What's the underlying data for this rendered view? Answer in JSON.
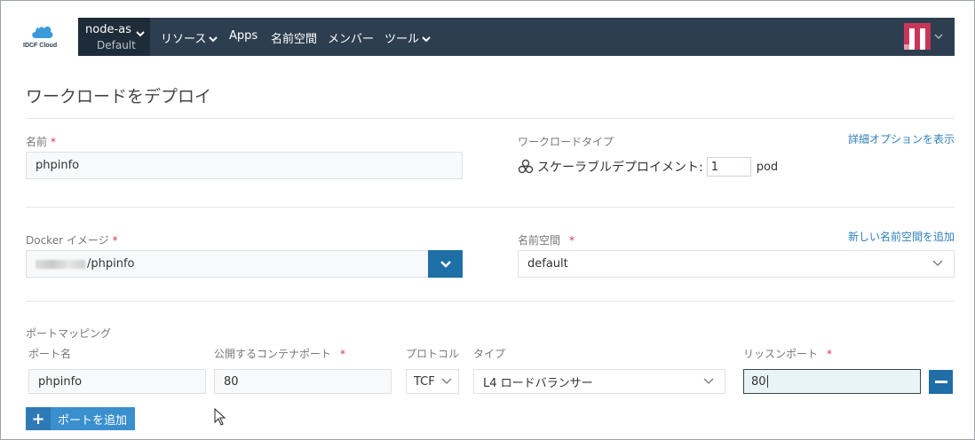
{
  "header": {
    "logo_text": "IDCF Cloud",
    "cluster": {
      "name": "node-as",
      "project": "Default"
    },
    "nav": [
      {
        "label": "リソース",
        "dropdown": true
      },
      {
        "label": "Apps",
        "dropdown": false
      },
      {
        "label": "名前空間",
        "dropdown": false
      },
      {
        "label": "メンバー",
        "dropdown": false
      },
      {
        "label": "ツール",
        "dropdown": true
      }
    ]
  },
  "page": {
    "title": "ワークロードをデプロイ"
  },
  "form": {
    "name": {
      "label": "名前",
      "value": "phpinfo"
    },
    "workload_type": {
      "label": "ワークロードタイプ",
      "option_label": "スケーラブルデプロイメント:",
      "count": "1",
      "unit": "pod",
      "advanced_link": "詳細オプションを表示"
    },
    "docker_image": {
      "label": "Docker イメージ",
      "value": "/phpinfo"
    },
    "namespace": {
      "label": "名前空間",
      "value": "default",
      "add_link": "新しい名前空間を追加"
    },
    "port_mapping": {
      "section_label": "ポートマッピング",
      "headers": {
        "port_name": "ポート名",
        "container_port": "公開するコンテナポート",
        "protocol": "プロトコル",
        "type": "タイプ",
        "listen_port": "リッスンポート"
      },
      "row": {
        "port_name": "phpinfo",
        "container_port": "80",
        "protocol": "TCF",
        "type": "L4 ロードバランサー",
        "listen_port": "80"
      },
      "add_button": "ポートを追加"
    }
  },
  "required_mark": "*",
  "colors": {
    "navbar": "#2d3e50",
    "primary": "#1d6fa5",
    "link": "#2f80b8",
    "required": "#d0384a"
  }
}
